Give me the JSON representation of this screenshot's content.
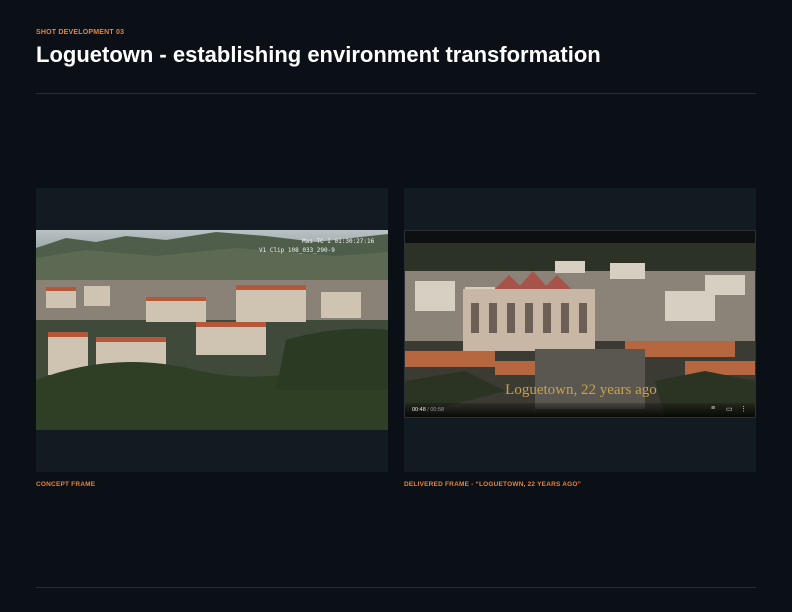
{
  "header": {
    "eyebrow": "SHOT DEVELOPMENT 03",
    "title": "Loguetown - establishing environment transformation"
  },
  "concept": {
    "caption": "CONCEPT FRAME",
    "timecode_line1": "Mas TC I  01:30:27:16",
    "timecode_line2": "V1 Clip 108_033_290-9"
  },
  "delivered": {
    "caption": "DELIVERED FRAME - “LOGUETOWN, 22 YEARS AGO”",
    "subtitle": "Loguetown, 22 years ago",
    "player": {
      "current_time": "00:48",
      "duration": "/ 00:58"
    }
  },
  "colors": {
    "accent": "#e8833a",
    "background": "#0a1016",
    "panel": "#121b22",
    "subtitle_gold": "#c8a24a"
  }
}
